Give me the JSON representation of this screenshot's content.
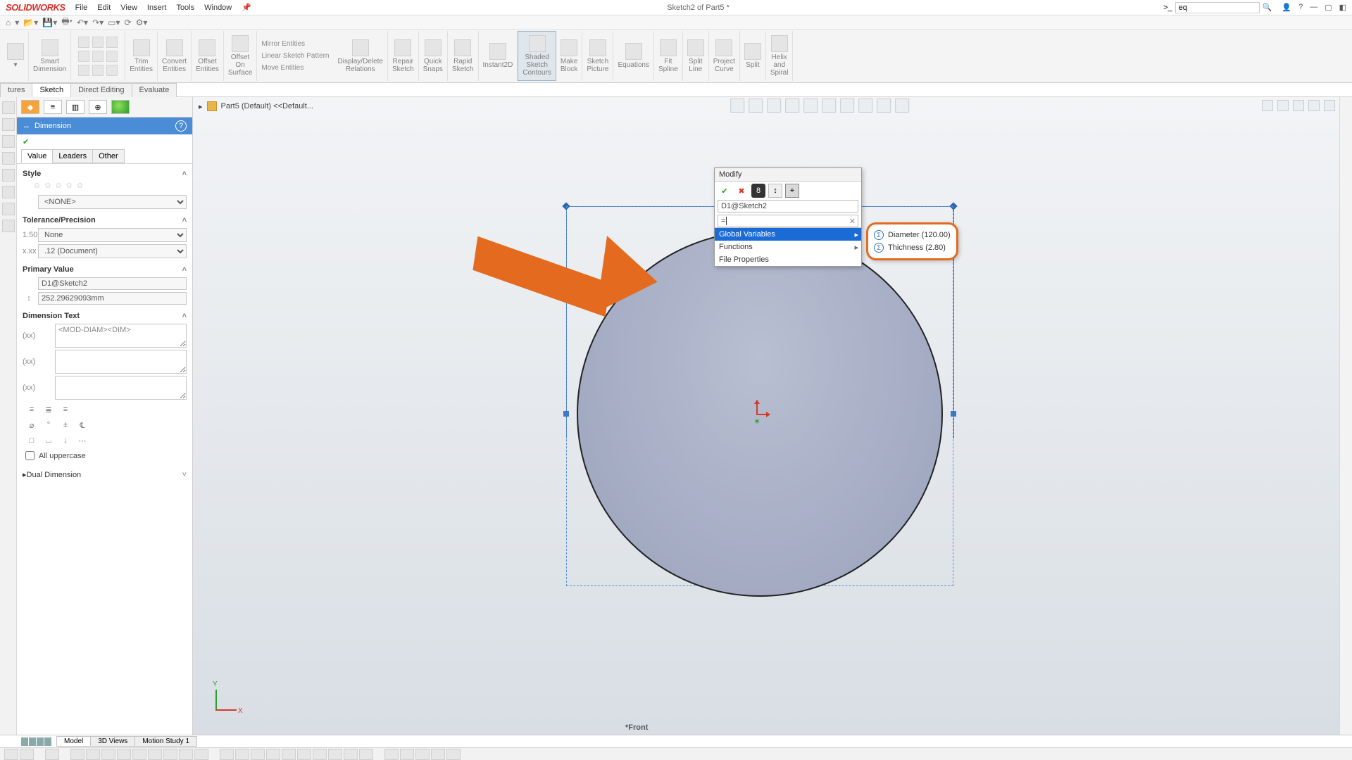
{
  "app": {
    "logo": "SOLIDWORKS"
  },
  "menu": [
    "File",
    "Edit",
    "View",
    "Insert",
    "Tools",
    "Window"
  ],
  "title_doc": "Sketch2 of Part5 *",
  "search": {
    "prefix_icon": ">_",
    "value": "eq"
  },
  "ribbon": {
    "smart_dim": "Smart\nDimension",
    "trim": "Trim\nEntities",
    "convert": "Convert\nEntities",
    "offset": "Offset\nEntities",
    "offset_surf": "Offset\nOn\nSurface",
    "mirror": "Mirror Entities",
    "linear": "Linear Sketch Pattern",
    "move": "Move Entities",
    "display": "Display/Delete\nRelations",
    "repair": "Repair\nSketch",
    "quick_snaps": "Quick\nSnaps",
    "rapid": "Rapid\nSketch",
    "instant2d": "Instant2D",
    "shaded": "Shaded\nSketch\nContours",
    "make_block": "Make\nBlock",
    "sketch_pic": "Sketch\nPicture",
    "equations": "Equations",
    "fit_spline": "Fit\nSpline",
    "split_line": "Split\nLine",
    "project_curve": "Project\nCurve",
    "split": "Split",
    "helix": "Helix\nand\nSpiral"
  },
  "tabs": {
    "features": "tures",
    "sketch": "Sketch",
    "direct": "Direct Editing",
    "evaluate": "Evaluate"
  },
  "tree_crumb": "Part5 (Default) <<Default...",
  "prop": {
    "header": "Dimension",
    "sub_tabs": {
      "value": "Value",
      "leaders": "Leaders",
      "other": "Other"
    },
    "style": {
      "title": "Style",
      "none": "<NONE>"
    },
    "tol": {
      "title": "Tolerance/Precision",
      "none": "None",
      "doc": ".12 (Document)"
    },
    "primary": {
      "title": "Primary Value",
      "name": "D1@Sketch2",
      "value": "252.29629093mm"
    },
    "dimtext": {
      "title": "Dimension Text",
      "value": "<MOD-DIAM><DIM>"
    },
    "all_upper": "All uppercase",
    "dual": "Dual Dimension"
  },
  "modify": {
    "title": "Modify",
    "name_field": "D1@Sketch2",
    "eq_field": "=",
    "menu": {
      "gv": "Global Variables",
      "fn": "Functions",
      "fp": "File Properties"
    }
  },
  "globals": [
    {
      "name": "Diameter",
      "value": "120.00"
    },
    {
      "name": "Thichness",
      "value": "2.80"
    }
  ],
  "axis": {
    "x": "X",
    "y": "Y"
  },
  "viewname": "*Front",
  "bottom_tabs": {
    "model": "Model",
    "views3d": "3D Views",
    "motion": "Motion Study 1"
  }
}
